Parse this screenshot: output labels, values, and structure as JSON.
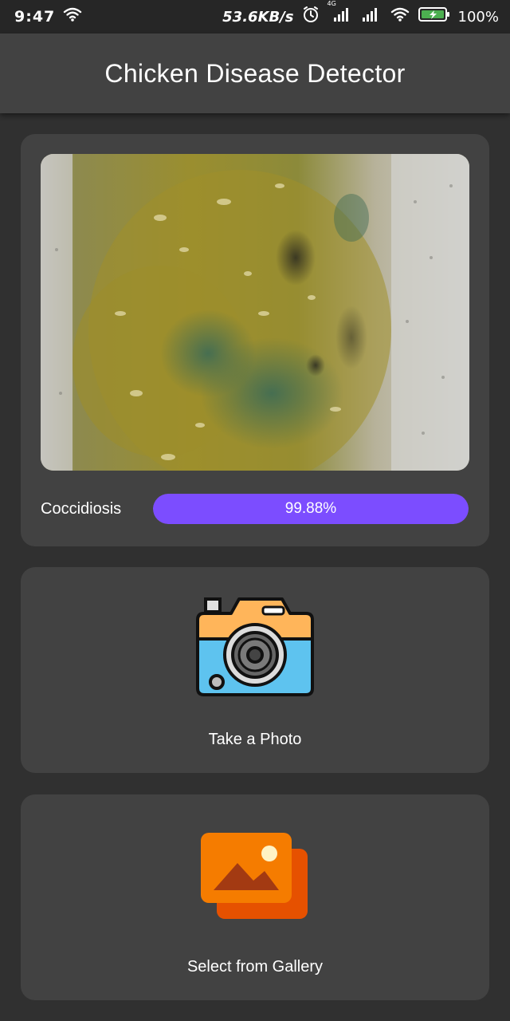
{
  "status_bar": {
    "time": "9:47",
    "network_speed": "53.6KB/s",
    "network_type": "4G",
    "battery_percent": "100%",
    "icons": [
      "wifi-icon",
      "alarm-icon",
      "signal-icon",
      "signal-icon",
      "wifi-icon",
      "battery-charging-icon"
    ]
  },
  "app_bar": {
    "title": "Chicken Disease Detector"
  },
  "result": {
    "image_icon": "sample-photo",
    "label": "Coccidiosis",
    "confidence_text": "99.88%",
    "confidence_value": 0.9988,
    "bar_color": "#7c4dff"
  },
  "actions": {
    "camera": {
      "icon": "camera-icon",
      "label": "Take a Photo"
    },
    "gallery": {
      "icon": "gallery-icon",
      "label": "Select from Gallery"
    }
  },
  "colors": {
    "background": "#303030",
    "app_bar": "#424242",
    "card": "#424242",
    "accent": "#7c4dff"
  }
}
